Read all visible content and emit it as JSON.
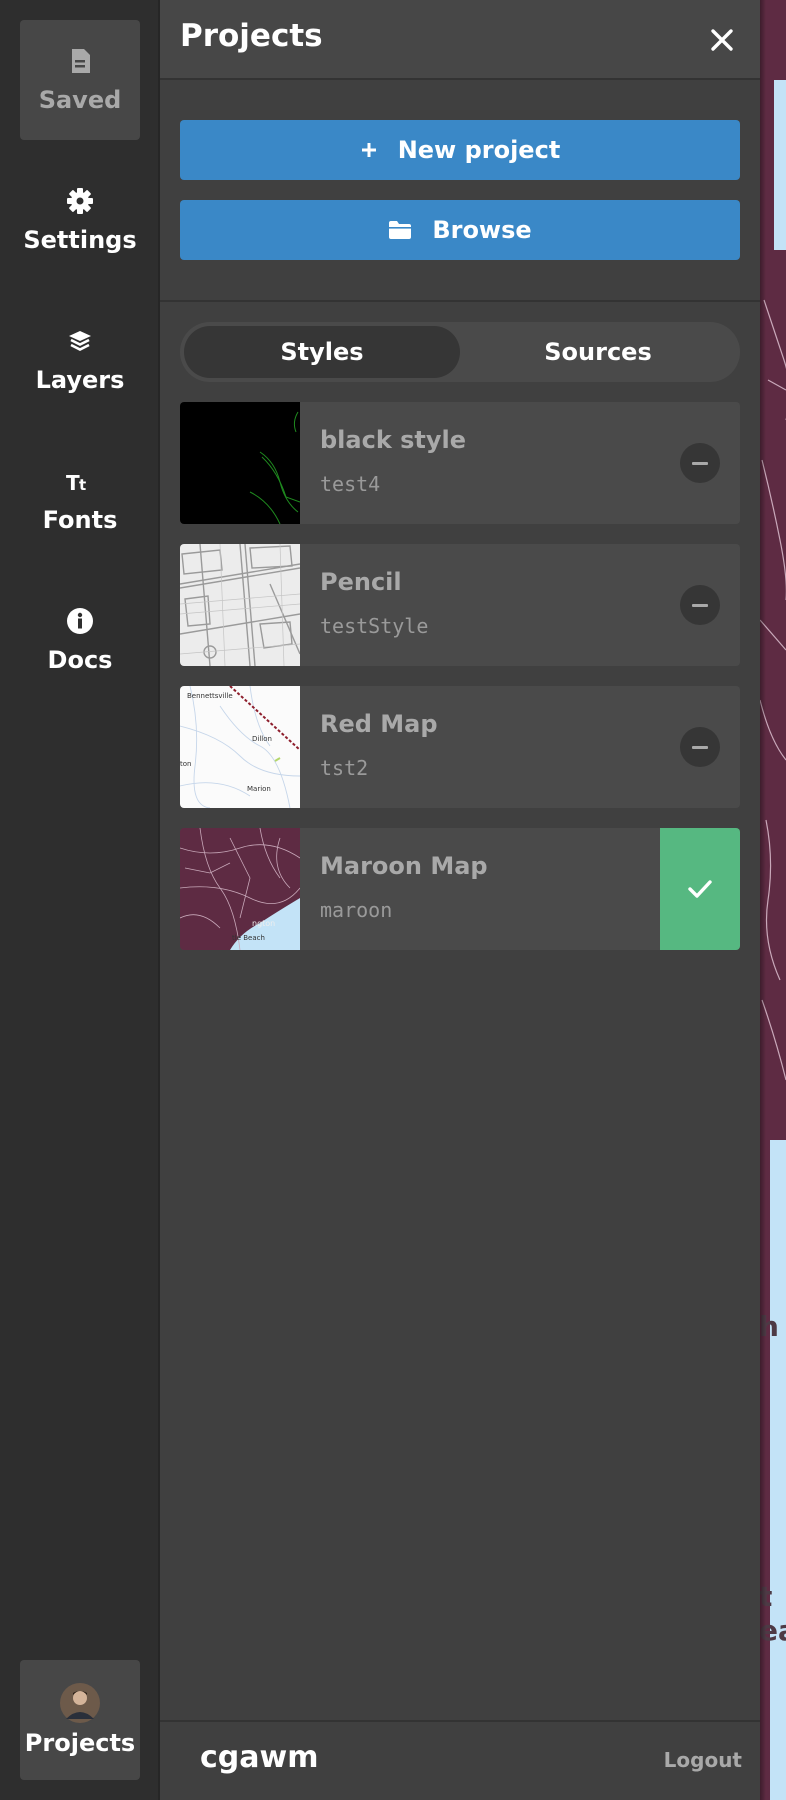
{
  "sidebar": {
    "items": [
      {
        "label": "Saved",
        "icon": "document-icon",
        "state": "active-disabled"
      },
      {
        "label": "Settings",
        "icon": "gear-icon"
      },
      {
        "label": "Layers",
        "icon": "layers-icon"
      },
      {
        "label": "Fonts",
        "icon": "text-size-icon"
      },
      {
        "label": "Docs",
        "icon": "info-icon"
      }
    ],
    "projects": {
      "label": "Projects",
      "icon": "avatar",
      "state": "active"
    }
  },
  "panel": {
    "title": "Projects",
    "new_project_label": "New project",
    "browse_label": "Browse",
    "tabs": [
      {
        "label": "Styles",
        "selected": true
      },
      {
        "label": "Sources",
        "selected": false
      }
    ],
    "styles": [
      {
        "name": "black style",
        "id": "test4",
        "thumbnail": "black-map-thumbnail",
        "selected": false
      },
      {
        "name": "Pencil",
        "id": "testStyle",
        "thumbnail": "pencil-map-thumbnail",
        "selected": false
      },
      {
        "name": "Red Map",
        "id": "tst2",
        "thumbnail": "red-map-thumbnail",
        "selected": false
      },
      {
        "name": "Maroon Map",
        "id": "maroon",
        "thumbnail": "maroon-map-thumbnail",
        "selected": true
      }
    ],
    "thumbnail_labels": {
      "red_map": [
        "Bennettsville",
        "Dillon",
        "Marion",
        "ton"
      ],
      "maroon_map": [
        "ngton",
        "tle Beach"
      ]
    },
    "footer": {
      "username": "cgawm",
      "logout_label": "Logout"
    }
  },
  "map_text": [
    "h",
    "t",
    "ea"
  ],
  "colors": {
    "sidebar_bg": "#2e2e2e",
    "panel_bg": "#404040",
    "card_bg": "#4a4a4a",
    "primary_button": "#3a88c7",
    "selected_green": "#56b881",
    "map_maroon": "#5e2b43",
    "water": "#c3e3f7"
  }
}
